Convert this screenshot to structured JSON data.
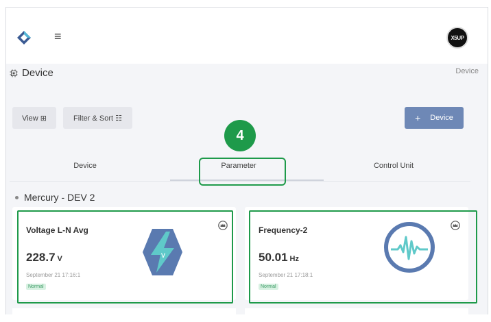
{
  "app": {
    "logo": "diamond-logo-icon",
    "menu_icon": "hamburger-icon",
    "avatar_text": "X5UP"
  },
  "page": {
    "title": "Device",
    "title_icon": "cpu-icon",
    "breadcrumb": "Device"
  },
  "toolbar": {
    "view_label": "View ⊞",
    "filter_label": "Filter & Sort ☷",
    "add_plus": "+",
    "add_label": "Device"
  },
  "tabs": [
    {
      "label": "Device"
    },
    {
      "label": "Parameter"
    },
    {
      "label": "Control Unit"
    }
  ],
  "annotation": {
    "step": "4",
    "highlight_color": "#1e9a4a"
  },
  "section": {
    "title": "Mercury - DEV 2"
  },
  "cards": [
    {
      "title": "Voltage L-N Avg",
      "value": "228.7",
      "unit": "V",
      "timestamp": "September 21 17:16:1",
      "status": "Normal",
      "icon": "lightning-icon"
    },
    {
      "title": "Frequency-2",
      "value": "50.01",
      "unit": "Hz",
      "timestamp": "September 21 17:18:1",
      "status": "Normal",
      "icon": "waveform-icon"
    }
  ],
  "colors": {
    "accent": "#6e88b6",
    "status_normal": "#3a9a63",
    "icon_blue": "#5a7ab0",
    "icon_teal": "#5fc9c9"
  }
}
